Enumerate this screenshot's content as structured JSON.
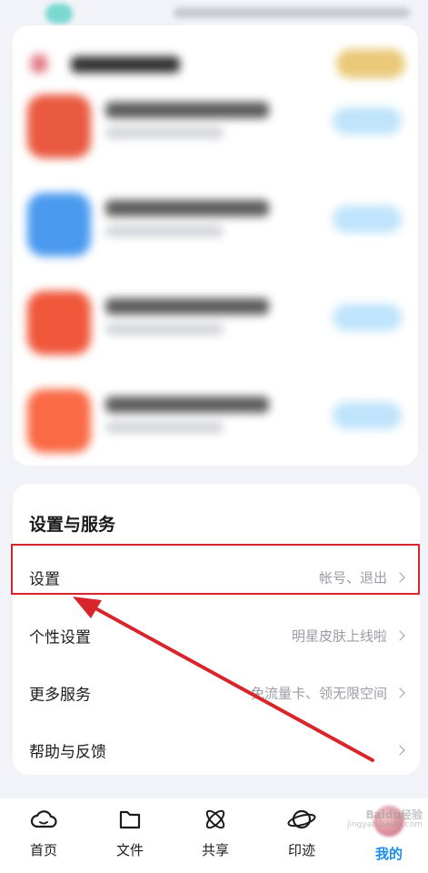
{
  "settings": {
    "section_title": "设置与服务",
    "rows": [
      {
        "label": "设置",
        "hint": "帐号、退出"
      },
      {
        "label": "个性设置",
        "hint": "明星皮肤上线啦"
      },
      {
        "label": "更多服务",
        "hint": "免流量卡、领无限空间"
      },
      {
        "label": "帮助与反馈",
        "hint": ""
      }
    ]
  },
  "promo": {
    "apps": [
      {
        "icon_color": "#e9593f"
      },
      {
        "icon_color": "#4a9af0"
      },
      {
        "icon_color": "#f0573a"
      },
      {
        "icon_color": "#f96a45"
      }
    ]
  },
  "tabs": [
    {
      "label": "首页",
      "icon": "cloud-icon"
    },
    {
      "label": "文件",
      "icon": "folder-icon"
    },
    {
      "label": "共享",
      "icon": "share-icon"
    },
    {
      "label": "印迹",
      "icon": "planet-icon"
    },
    {
      "label": "我的",
      "icon": "avatar",
      "active": true
    }
  ],
  "watermark": {
    "brand": "Baidu经验",
    "url": "jingyan.baidu.com"
  },
  "colors": {
    "accent": "#1a8cf0",
    "highlight": "#d8252b",
    "hint": "#9a9ca3"
  }
}
